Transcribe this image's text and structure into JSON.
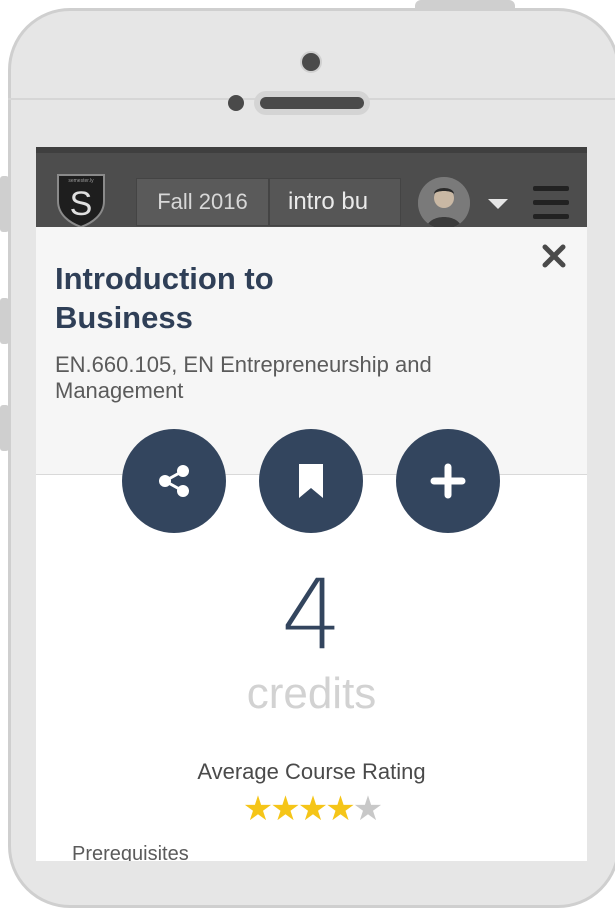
{
  "navbar": {
    "logo_letter": "S",
    "logo_text": "semester.ly",
    "semester": "Fall 2016",
    "search_value": "intro bu",
    "menu_icon": "hamburger-icon"
  },
  "course": {
    "title": "Introduction to Business",
    "subtitle": "EN.660.105, EN Entrepreneurship and Management",
    "credits_value": "4",
    "credits_label": "credits",
    "rating_title": "Average Course Rating",
    "rating": 4,
    "rating_max": 5,
    "prereq_label": "Prerequisites"
  },
  "actions": {
    "share_icon": "share-icon",
    "save_icon": "bookmark-icon",
    "add_icon": "plus-icon",
    "close_icon": "close-icon"
  },
  "colors": {
    "accent": "#33455e",
    "navbar": "#4d4d4d",
    "star_filled": "#f5c518",
    "star_empty": "#c8c8c8"
  }
}
